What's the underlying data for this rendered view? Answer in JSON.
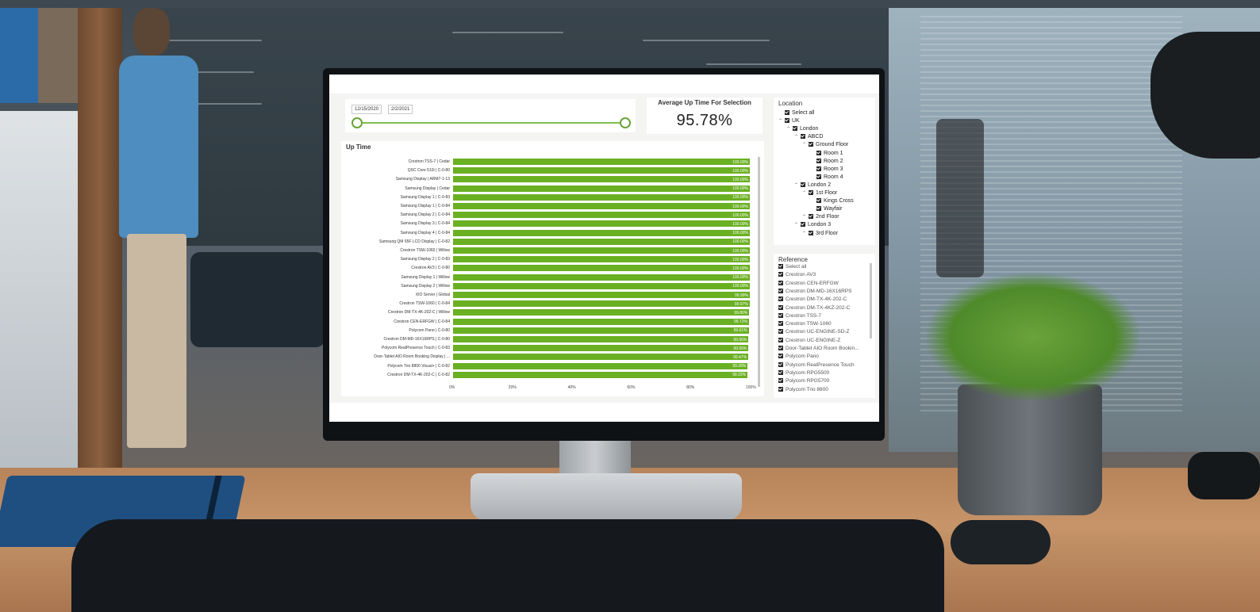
{
  "date_slicer": {
    "start": "12/15/2020",
    "end": "2/2/2021"
  },
  "kpi": {
    "title": "Average Up Time For Selection",
    "value": "95.78%"
  },
  "chart_data": {
    "type": "bar",
    "orientation": "horizontal",
    "title": "Up Time",
    "categories": [
      "Crestron TSS-7 | Cedar",
      "QSC Core 510i | C-0-80",
      "Samsung Display | ARM7-1-13",
      "Samsung Display | Cedar",
      "Samsung Display 1 | C-0-83",
      "Samsung Display 1 | C-0-84",
      "Samsung Display 2 | C-0-84",
      "Samsung Display 3 | C-0-84",
      "Samsung Display 4 | C-0-84",
      "Samsung QM 65F LCD Display | C-0-82",
      "Crestron TSW-1060 | Willow",
      "Samsung Display 2 | C-0-83",
      "Crestron AV3 | C-0-80",
      "Samsung Display 1 | Willow",
      "Samsung Display 2 | Willow",
      "XIO Server | Global",
      "Crestron TSW-1060 | C-0-84",
      "Crestron DM-TX-4K-202-C | Willow",
      "Crestron CEN-ERFGW | C-0-84",
      "Polycom Pano | C-0-80",
      "Crestron DM-MD-16X16RPS | C-0-80",
      "Polycom RealPresence Touch | C-0-83",
      "Door-Tablet AIO Room Booking Display | ...",
      "Polycom Trio 8800 Visual+ | C-0-82",
      "Crestron DM-TX-4K-202-C | C-0-82"
    ],
    "values": [
      100,
      100,
      100,
      100,
      100,
      100,
      100,
      100,
      100,
      100,
      100,
      100,
      100,
      100,
      100,
      99.99,
      99.97,
      99.8,
      99.72,
      99.61,
      99.56,
      99.56,
      99.47,
      99.28,
      99.22
    ],
    "value_labels": [
      "100.00%",
      "100.00%",
      "100.00%",
      "100.00%",
      "100.00%",
      "100.00%",
      "100.00%",
      "100.00%",
      "100.00%",
      "100.00%",
      "100.00%",
      "100.00%",
      "100.00%",
      "100.00%",
      "100.00%",
      "99.99%",
      "99.97%",
      "99.80%",
      "99.72%",
      "99.61%",
      "99.56%",
      "99.56%",
      "99.47%",
      "99.28%",
      "99.22%"
    ],
    "xlim": [
      0,
      100
    ],
    "x_ticks": [
      "0%",
      "20%",
      "40%",
      "60%",
      "80%",
      "100%"
    ],
    "bar_color": "#6ab023"
  },
  "location": {
    "title": "Location",
    "items": [
      {
        "label": "Select all",
        "level": 0,
        "caret": false
      },
      {
        "label": "UK",
        "level": 0,
        "caret": true
      },
      {
        "label": "London",
        "level": 1,
        "caret": true
      },
      {
        "label": "ABCD",
        "level": 2,
        "caret": true
      },
      {
        "label": "Ground Floor",
        "level": 3,
        "caret": true
      },
      {
        "label": "Room 1",
        "level": 4,
        "caret": false
      },
      {
        "label": "Room 2",
        "level": 4,
        "caret": false
      },
      {
        "label": "Room 3",
        "level": 4,
        "caret": false
      },
      {
        "label": "Room 4",
        "level": 4,
        "caret": false
      },
      {
        "label": "London 2",
        "level": 2,
        "caret": true
      },
      {
        "label": "1st Floor",
        "level": 3,
        "caret": true
      },
      {
        "label": "Kings Cross",
        "level": 4,
        "caret": false
      },
      {
        "label": "Wayfair",
        "level": 4,
        "caret": false
      },
      {
        "label": "2nd Floor",
        "level": 3,
        "caret": true
      },
      {
        "label": "London 3",
        "level": 2,
        "caret": true
      },
      {
        "label": "3rd Floor",
        "level": 3,
        "caret": true
      }
    ]
  },
  "reference": {
    "title": "Reference",
    "items": [
      "Select all",
      "Crestron AV3",
      "Crestron CEN-ERFGW",
      "Crestron DM-MD-16X16RPS",
      "Crestron DM-TX-4K-202-C",
      "Crestron DM-TX-4KZ-202-C",
      "Crestron TSS-7",
      "Crestron TSW-1060",
      "Crestron UC-ENGINE-SD-Z",
      "Crestron UC-ENGINE-Z",
      "Door-Tablet AIO Room Bookin...",
      "Polycom Pano",
      "Polycom RealPresence Touch",
      "Polycom RPG5500",
      "Polycom RPG5700",
      "Polycom Trio 8800"
    ]
  }
}
